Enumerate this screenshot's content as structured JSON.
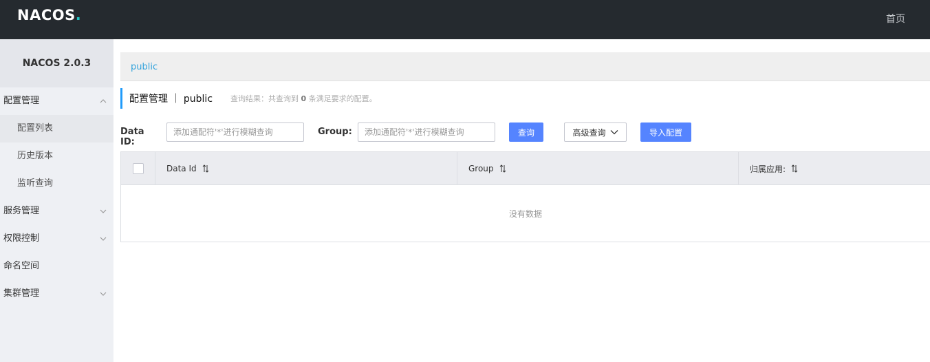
{
  "header": {
    "logo_text": "NACOS",
    "home_label": "首页"
  },
  "sidebar": {
    "version": "NACOS 2.0.3",
    "items": [
      {
        "label": "配置管理"
      },
      {
        "label": "配置列表"
      },
      {
        "label": "历史版本"
      },
      {
        "label": "监听查询"
      },
      {
        "label": "服务管理"
      },
      {
        "label": "权限控制"
      },
      {
        "label": "命名空间"
      },
      {
        "label": "集群管理"
      }
    ]
  },
  "namespace_bar": {
    "active": "public"
  },
  "page": {
    "title": "配置管理 ｜ public",
    "result_prefix": "查询结果：共查询到",
    "result_count": "0",
    "result_suffix": "条满足要求的配置。"
  },
  "filters": {
    "data_id_label": "Data ID:",
    "data_id_placeholder": "添加通配符'*'进行模糊查询",
    "group_label": "Group:",
    "group_placeholder": "添加通配符'*'进行模糊查询",
    "query_button": "查询",
    "advanced_button": "高级查询",
    "import_button": "导入配置"
  },
  "table": {
    "columns": [
      "Data Id",
      "Group",
      "归属应用:"
    ],
    "empty_text": "没有数据"
  },
  "colors": {
    "topbar": "#252a2f",
    "primary": "#5584ff",
    "accent": "#209bfa"
  }
}
